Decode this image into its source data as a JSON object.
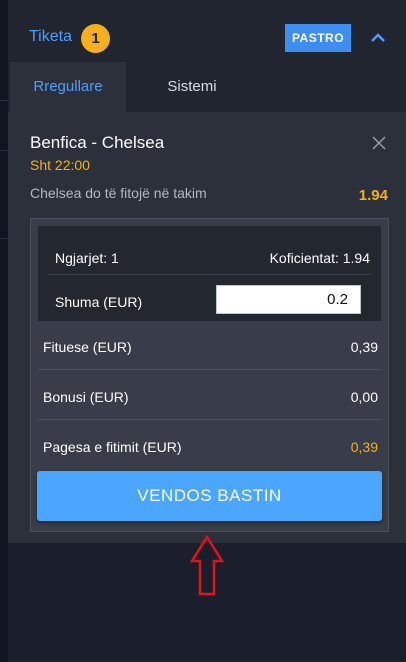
{
  "header": {
    "title": "Tiketa",
    "count": "1",
    "clear_label": "PASTRO"
  },
  "tabs": [
    {
      "label": "Rregullare"
    },
    {
      "label": "Sistemi"
    }
  ],
  "bet": {
    "match": "Benfica - Chelsea",
    "time": "Sht 22:00",
    "selection": "Chelsea do të fitojë në takim",
    "odd": "1.94"
  },
  "summary": {
    "events_label": "Ngjarjet: 1",
    "odds_label": "Koficientat: 1.94",
    "stake_label": "Shuma (EUR)",
    "stake_value": "0.2",
    "win_label": "Fituese (EUR)",
    "win_value": "0,39",
    "bonus_label": "Bonusi (EUR)",
    "bonus_value": "0,00",
    "payout_label": "Pagesa e fitimit (EUR)",
    "payout_value": "0,39"
  },
  "place_button": "VENDOS BASTIN",
  "colors": {
    "accent": "#4d9fff",
    "highlight": "#f5b01b",
    "button": "#4aa6ff",
    "annotation": "#e0141b"
  }
}
